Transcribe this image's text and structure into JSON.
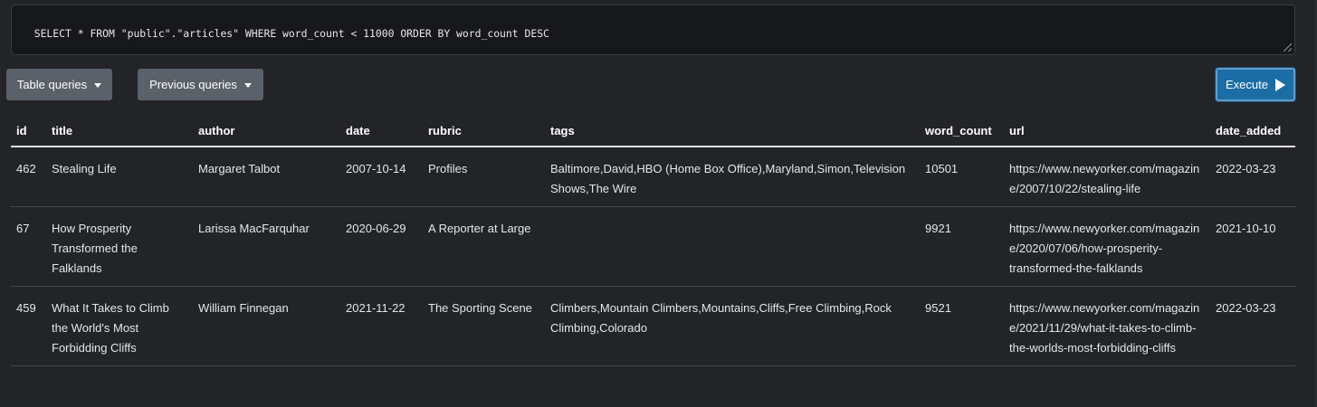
{
  "query": {
    "text": "SELECT * FROM \"public\".\"articles\" WHERE word_count < 11000 ORDER BY word_count DESC"
  },
  "toolbar": {
    "table_queries_label": "Table queries",
    "previous_queries_label": "Previous queries",
    "execute_label": "Execute"
  },
  "table": {
    "columns": [
      "id",
      "title",
      "author",
      "date",
      "rubric",
      "tags",
      "word_count",
      "url",
      "date_added"
    ],
    "rows": [
      {
        "id": "462",
        "title": "Stealing Life",
        "author": "Margaret Talbot",
        "date": "2007-10-14",
        "rubric": "Profiles",
        "tags": "Baltimore,David,HBO (Home Box Office),Maryland,Simon,Television Shows,The Wire",
        "word_count": "10501",
        "url": "https://www.newyorker.com/magazine/2007/10/22/stealing-life",
        "date_added": "2022-03-23"
      },
      {
        "id": "67",
        "title": "How Prosperity Transformed the Falklands",
        "author": "Larissa MacFarquhar",
        "date": "2020-06-29",
        "rubric": "A Reporter at Large",
        "tags": "",
        "word_count": "9921",
        "url": "https://www.newyorker.com/magazine/2020/07/06/how-prosperity-transformed-the-falklands",
        "date_added": "2021-10-10"
      },
      {
        "id": "459",
        "title": "What It Takes to Climb the World's Most Forbidding Cliffs",
        "author": "William Finnegan",
        "date": "2021-11-22",
        "rubric": "The Sporting Scene",
        "tags": "Climbers,Mountain Climbers,Mountains,Cliffs,Free Climbing,Rock Climbing,Colorado",
        "word_count": "9521",
        "url": "https://www.newyorker.com/magazine/2021/11/29/what-it-takes-to-climb-the-worlds-most-forbidding-cliffs",
        "date_added": "2022-03-23"
      }
    ]
  }
}
